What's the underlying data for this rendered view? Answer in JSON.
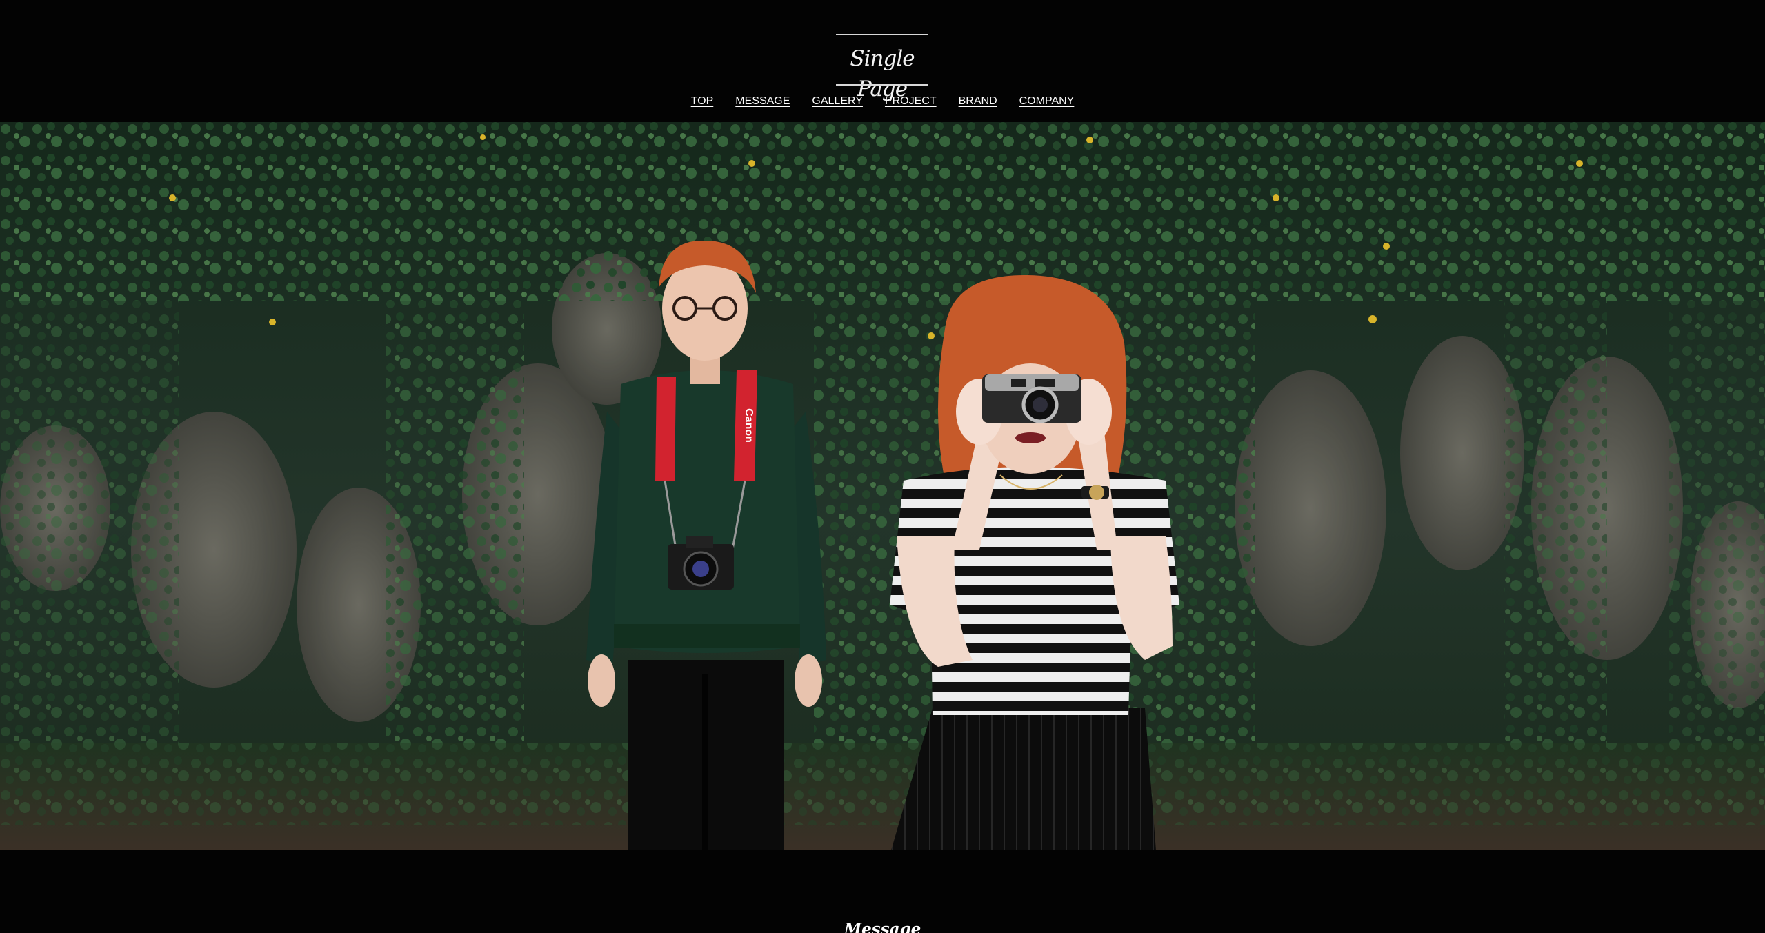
{
  "header": {
    "logo_text": "Single Page"
  },
  "nav": {
    "items": [
      {
        "label": "TOP"
      },
      {
        "label": "MESSAGE"
      },
      {
        "label": "GALLERY"
      },
      {
        "label": "PROJECT"
      },
      {
        "label": "BRAND"
      },
      {
        "label": "COMPANY"
      }
    ]
  },
  "hero": {
    "strap_text": "Canon"
  },
  "message_section": {
    "title": "Message"
  },
  "colors": {
    "background": "#030303",
    "text": "#ffffff",
    "ivy_dark": "#1a3a22",
    "ivy_mid": "#2f5a35",
    "stone": "#5e5a52",
    "hair": "#c65a2a",
    "sweater": "#18392b",
    "strap": "#d2232f"
  }
}
